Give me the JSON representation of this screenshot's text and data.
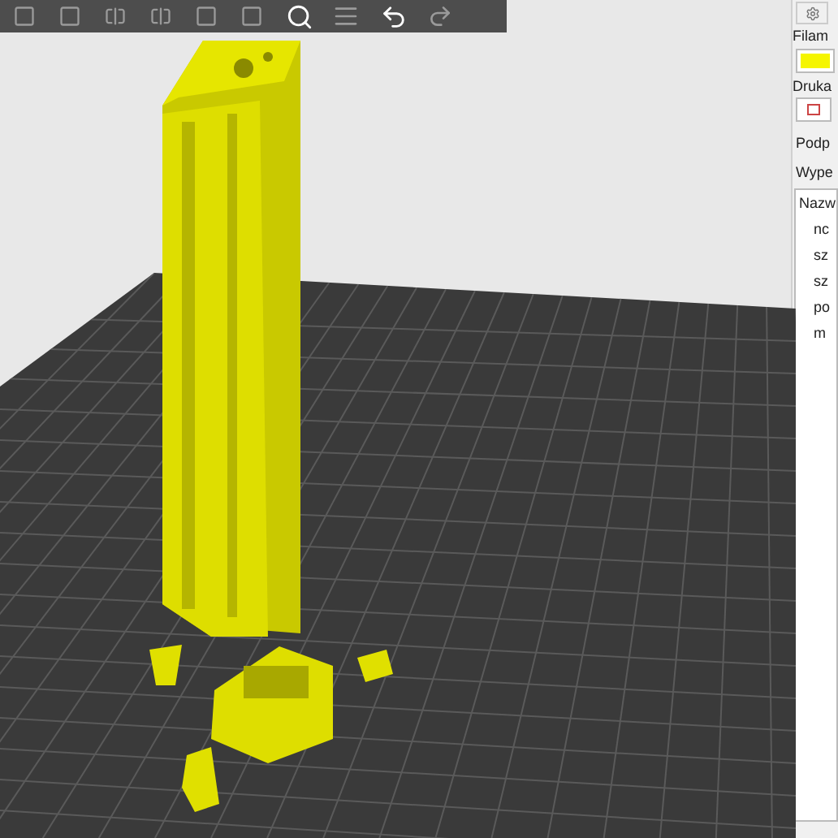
{
  "sidebar": {
    "filament_label": "Filam",
    "filament": {
      "color": "#f5f500"
    },
    "printer_label": "Druka",
    "support_label": "Podp",
    "infill_label": "Wype",
    "object_list": {
      "header": "Nazw",
      "items": [
        {
          "label": "nc"
        },
        {
          "label": "sz"
        },
        {
          "label": "sz"
        },
        {
          "label": "po"
        },
        {
          "label": "m"
        }
      ]
    }
  }
}
